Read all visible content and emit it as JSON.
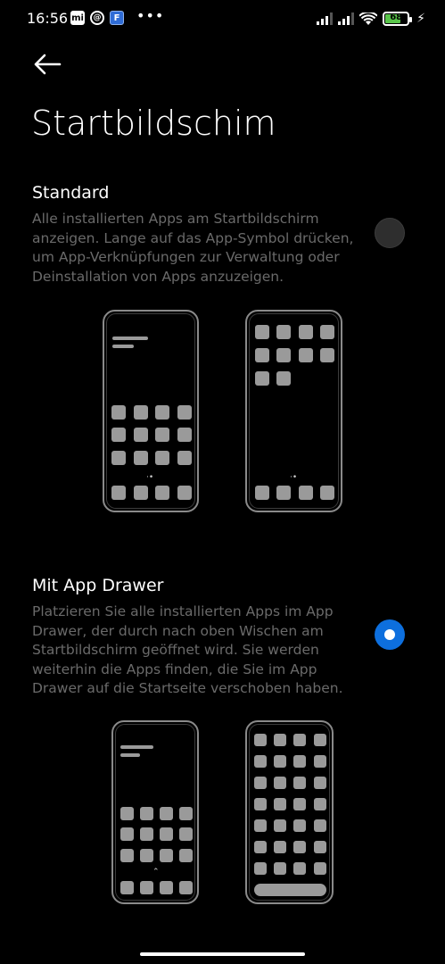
{
  "status_bar": {
    "time": "16:56",
    "notification_icons": [
      "mi-icon",
      "at-icon",
      "app-box-icon"
    ],
    "more": "•••",
    "battery_level": "68",
    "battery_color": "#59c54a"
  },
  "page": {
    "title": "Startbildschim"
  },
  "options": [
    {
      "title": "Standard",
      "description": "Alle installierten Apps am Startbildschirm anzeigen. Lange auf das App-Symbol drücken, um App-Verknüpfungen zur Verwaltung oder Deinstallation von Apps anzuzeigen.",
      "selected": false
    },
    {
      "title": "Mit App Drawer",
      "description": "Platzieren Sie alle installierten Apps im App Drawer, der durch nach oben Wischen am Startbildschirm geöffnet wird. Sie werden weiterhin die Apps finden, die Sie im App Drawer auf die Startseite verschoben haben.",
      "selected": true
    }
  ],
  "colors": {
    "accent": "#0d6fde",
    "background": "#000000",
    "secondary_text": "#6a6a6a"
  }
}
